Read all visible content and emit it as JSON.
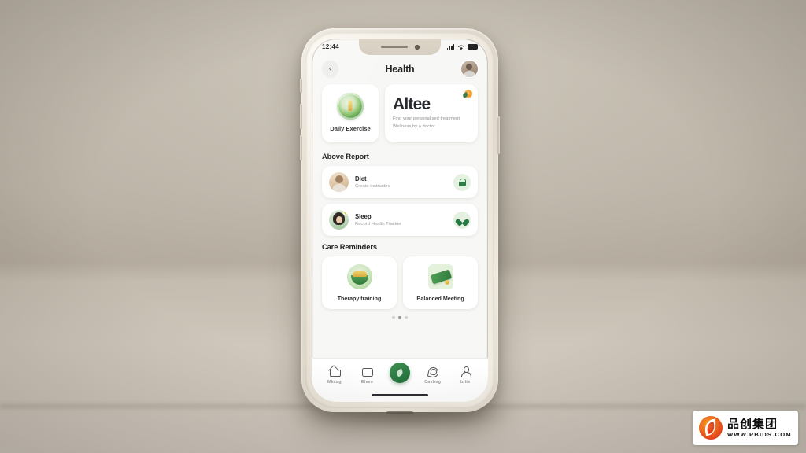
{
  "scene": {
    "background_color": "#b6aea1",
    "device": "smartphone-mockup"
  },
  "phone": {
    "status_bar": {
      "time": "12:44",
      "signal": "signal-bars",
      "wifi": "wifi",
      "battery": "battery-full"
    },
    "header": {
      "back_label": "‹",
      "title": "Health",
      "avatar_label": "profile"
    },
    "top_cards": {
      "exercise": {
        "caption": "Daily Exercise",
        "icon": "activity-ring-icon"
      },
      "brand": {
        "name": "Altee",
        "subtitle_line1": "Find your personalised treatment",
        "subtitle_line2": "Wellness by a doctor",
        "badge": "›"
      }
    },
    "sections": {
      "above_report": "Above Report",
      "care_reminders": "Care Reminders"
    },
    "report_rows": [
      {
        "title": "Diet",
        "subtitle": "Create instructed",
        "badge_icon": "lock-icon",
        "avatar": "avatar-person-1",
        "has_status_dot": false
      },
      {
        "title": "Sleep",
        "subtitle": "Record Health Tracker",
        "badge_icon": "heart-icon",
        "avatar": "avatar-person-2",
        "has_status_dot": true
      }
    ],
    "reminder_cards": [
      {
        "caption": "Therapy training",
        "icon": "salad-bowl-icon"
      },
      {
        "caption": "Balanced Meeting",
        "icon": "ticket-icon"
      }
    ],
    "pagination": {
      "dots": 3,
      "active_index": 1
    },
    "tab_bar": {
      "items": [
        {
          "label": "Mkcag",
          "icon": "home-icon",
          "active": false
        },
        {
          "label": "Elves",
          "icon": "square-icon",
          "active": false
        },
        {
          "label": "",
          "icon": "leaf-fab-icon",
          "active": true
        },
        {
          "label": "Cavbvg",
          "icon": "spiral-icon",
          "active": false
        },
        {
          "label": "brite",
          "icon": "person-icon",
          "active": false
        }
      ]
    },
    "colors": {
      "accent_green": "#2f7a45",
      "accent_orange": "#ec9527",
      "screen_bg": "#f7f7f5",
      "card_bg": "#ffffff"
    }
  },
  "watermark": {
    "brand_cn": "品创集团",
    "url": "WWW.PBIDS.COM"
  }
}
